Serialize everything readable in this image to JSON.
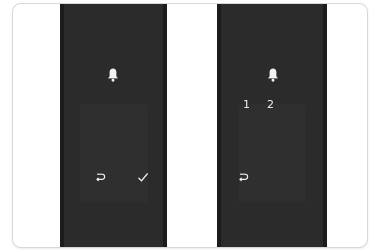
{
  "colors": {
    "background": "#ffffff",
    "panel": "#2b2b2b",
    "panel_edge": "#1c1c1c",
    "icon": "#f2f2f2"
  },
  "left_panel": {
    "icons": {
      "top": "bell-icon",
      "back": "back-arrow-icon",
      "confirm": "checkmark-icon"
    }
  },
  "right_panel": {
    "icons": {
      "top": "bell-icon",
      "back": "back-arrow-icon"
    },
    "entered_digits": [
      "1",
      "2"
    ]
  }
}
